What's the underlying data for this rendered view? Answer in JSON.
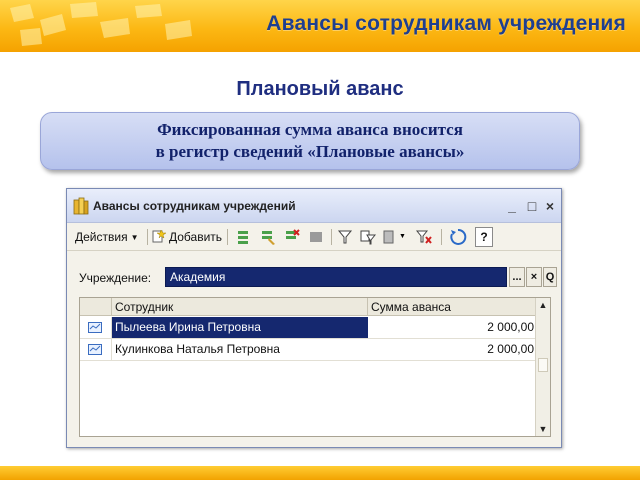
{
  "slide": {
    "header_title": "Авансы сотрудникам учреждения",
    "subtitle": "Плановый аванс",
    "callout_lines": [
      "Фиксированная сумма аванса вносится",
      "в регистр сведений «Плановые авансы»"
    ]
  },
  "window": {
    "title": "Авансы сотрудникам учреждений",
    "controls": {
      "minimize": "_",
      "maximize": "□",
      "close": "×"
    },
    "toolbar": {
      "actions_label": "Действия",
      "add_label": "Добавить",
      "help_label": "?"
    },
    "filter": {
      "label": "Учреждение:",
      "value": "Академия",
      "select_button": "...",
      "clear_button": "×",
      "search_button": "Q"
    },
    "table": {
      "columns": [
        "Сотрудник",
        "Сумма аванса"
      ],
      "rows": [
        {
          "employee": "Пылеева Ирина Петровна",
          "amount": "2 000,00",
          "selected": true
        },
        {
          "employee": "Кулинкова Наталья Петровна",
          "amount": "2 000,00",
          "selected": false
        }
      ]
    },
    "scroll": {
      "up": "▲",
      "down": "▼"
    }
  },
  "colors": {
    "header_gradient": "#fcb814",
    "title_blue": "#1f3f8f",
    "selection": "#15286f"
  }
}
